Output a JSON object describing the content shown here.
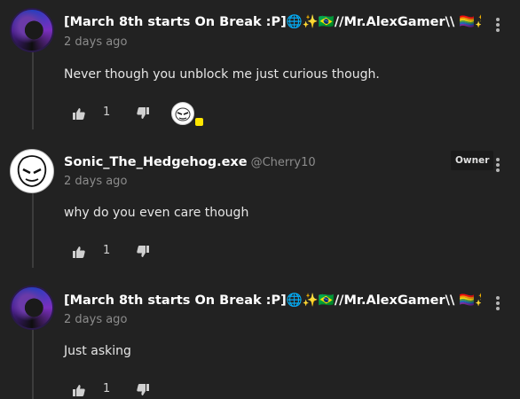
{
  "colors": {
    "background": "#222222",
    "thread_line": "#3c3c3c",
    "online_indicator": "#ffe600"
  },
  "comments": [
    {
      "username": "[March 8th starts On Break :P]🌐✨🇧🇷//Mr.AlexGamer\\\\ 🏳️‍🌈✨🌐#...",
      "handle": "",
      "time": "2 days ago",
      "text": "Never though you unblock me just curious though.",
      "upvotes": "1",
      "badge": "",
      "avatar_icon": "gamer-avatar-icon",
      "has_reply_avatar": true
    },
    {
      "username": "Sonic_The_Hedgehog.exe",
      "handle": "@Cherry10",
      "time": "2 days ago",
      "text": "why do you even care though",
      "upvotes": "1",
      "badge": "Owner",
      "avatar_icon": "sonic-avatar-icon",
      "has_reply_avatar": false
    },
    {
      "username": "[March 8th starts On Break :P]🌐✨🇧🇷//Mr.AlexGamer\\\\ 🏳️‍🌈✨🌐#...",
      "handle": "",
      "time": "2 days ago",
      "text": "Just asking",
      "upvotes": "1",
      "badge": "",
      "avatar_icon": "gamer-avatar-icon",
      "has_reply_avatar": false
    }
  ],
  "icons": {
    "upvote": "thumbs-up-icon",
    "downvote": "thumbs-down-icon",
    "menu": "more-vertical-icon"
  }
}
